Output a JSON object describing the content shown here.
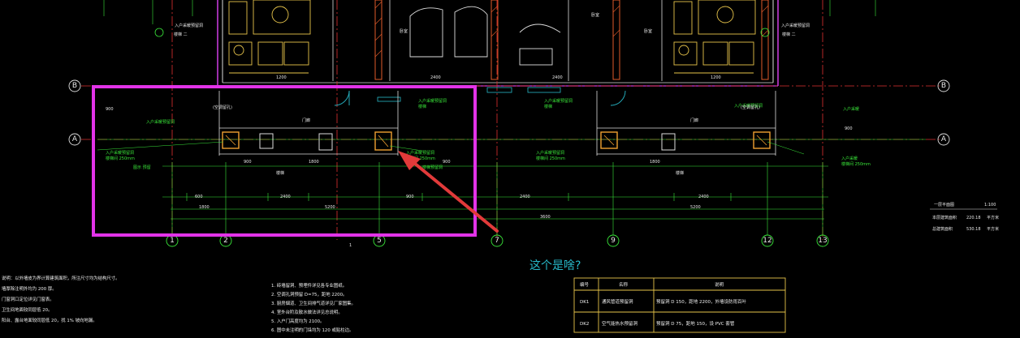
{
  "question": "这个是啥?",
  "axis_bubbles": {
    "vertical": [
      "1",
      "2",
      "5",
      "7",
      "9",
      "12",
      "13"
    ],
    "horizontal_left": [
      "B",
      "A"
    ],
    "horizontal_right": [
      "B",
      "A"
    ]
  },
  "dim_labels": {
    "row_total": "5200",
    "row_a": [
      "2400",
      "2400"
    ],
    "mid_marker": "1"
  },
  "rooms": {
    "left_hall": "门廊",
    "right_hall": "门廊",
    "stair_left": "楼梯",
    "stair_right": "楼梯"
  },
  "legend_block": {
    "title": "一层平面图",
    "scale": "1:100",
    "row1_label": "本层建筑面积",
    "row1_value": "220.18",
    "row1_unit": "平方米",
    "row2_label": "总建筑面积",
    "row2_value": "530.18",
    "row2_unit": "平方米"
  },
  "notes_left": [
    "说明：以外墙皮为界计算建筑面积，所注尺寸均为结构尺寸。",
    "墙厚除注明外均为 200 厚。",
    "门窗洞口定位详见门窗表。",
    "卫生间地面较同层低 20。",
    "阳台、露台地面较同层低 20，找 1% 坡向地漏。"
  ],
  "notes_mid": [
    "1. 砖墙留洞、预埋件详见各专业图纸。",
    "2. 空调孔洞预留 D=75，距地 2200。",
    "3. 厨房烟道、卫生间排气道详见厂家图集。",
    "4. 室外台阶及散水做法详见总说明。",
    "5. 入户门高度均为 2100。",
    "6. 图中未注明的门垛均为 120 或贴柱边。"
  ],
  "table": {
    "headers": [
      "编号",
      "名称",
      "说明"
    ],
    "rows": [
      [
        "DK1",
        "通风管道预留洞",
        "预留洞 D 150，距地 2200，外墙设防雨百叶"
      ],
      [
        "DK2",
        "空气能热水预留洞",
        "预留洞 D 75，距地 150，设 PVC 套管"
      ]
    ]
  }
}
